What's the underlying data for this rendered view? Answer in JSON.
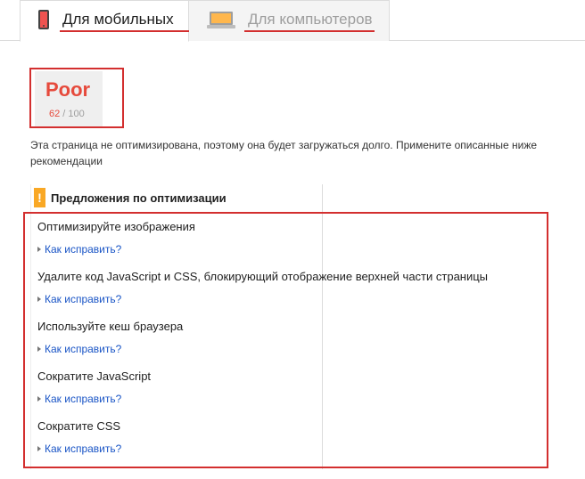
{
  "tabs": {
    "mobile_label": "Для мобильных",
    "desktop_label": "Для компьютеров",
    "active": "mobile"
  },
  "score": {
    "rating": "Poor",
    "value": "62",
    "separator": " / ",
    "max": "100"
  },
  "description": "Эта страница не оптимизирована, поэтому она будет загружаться долго. Примените описанные ниже рекомендации",
  "suggestions": {
    "title": "Предложения по оптимизации",
    "icon": "warning-icon",
    "items": [
      {
        "title": "Оптимизируйте изображения",
        "link": "Как исправить?"
      },
      {
        "title": "Удалите код JavaScript и CSS, блокирующий отображение верхней части страницы",
        "link": "Как исправить?"
      },
      {
        "title": "Используйте кеш браузера",
        "link": "Как исправить?"
      },
      {
        "title": "Сократите JavaScript",
        "link": "Как исправить?"
      },
      {
        "title": "Сократите CSS",
        "link": "Как исправить?"
      }
    ]
  },
  "colors": {
    "accent_red": "#d32f2f",
    "score_red": "#e64a3c",
    "link_blue": "#1a55c6",
    "warning_yellow": "#f9a825"
  }
}
